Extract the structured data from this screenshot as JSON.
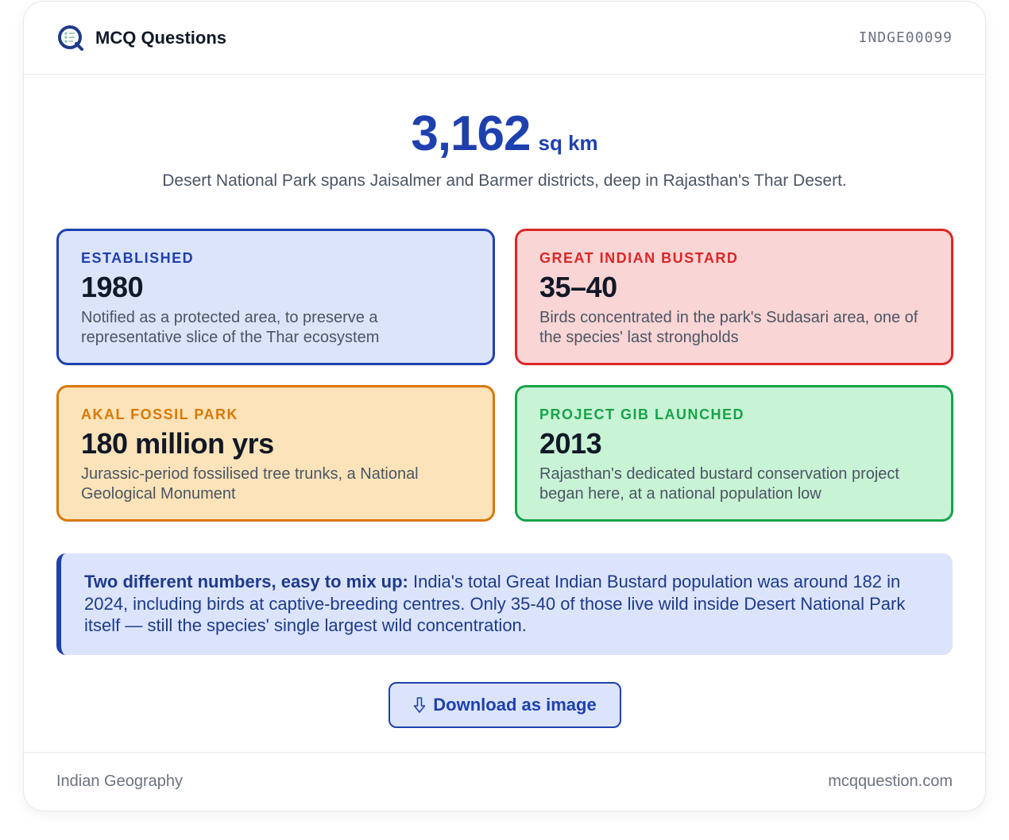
{
  "header": {
    "brand": "MCQ Questions",
    "code": "INDGE00099"
  },
  "hero": {
    "number": "3,162",
    "unit": "sq km",
    "subtitle": "Desert National Park spans Jaisalmer and Barmer districts, deep in Rajasthan's Thar Desert."
  },
  "stats": [
    {
      "label": "ESTABLISHED",
      "value": "1980",
      "desc": "Notified as a protected area, to preserve a representative slice of the Thar ecosystem",
      "accent": "#1e40af",
      "bg": "#dce4fa"
    },
    {
      "label": "GREAT INDIAN BUSTARD",
      "value": "35–40",
      "desc": "Birds concentrated in the park's Sudasari area, one of the species' last strongholds",
      "accent": "#dc2626",
      "bg": "#fad5d6"
    },
    {
      "label": "AKAL FOSSIL PARK",
      "value": "180 million yrs",
      "desc": "Jurassic-period fossilised tree trunks, a National Geological Monument",
      "accent": "#d97706",
      "bg": "#fce3b9"
    },
    {
      "label": "PROJECT GIB LAUNCHED",
      "value": "2013",
      "desc": "Rajasthan's dedicated bustard conservation project began here, at a national population low",
      "accent": "#16a34a",
      "bg": "#c8f3d5"
    }
  ],
  "note": {
    "lead": "Two different numbers, easy to mix up:",
    "text": " India's total Great Indian Bustard population was around 182 in 2024, including birds at captive-breeding centres. Only 35-40 of those live wild inside Desert National Park itself — still the species' single largest wild concentration."
  },
  "download": {
    "label": "Download as image",
    "icon": "download-arrow-icon"
  },
  "footer": {
    "category": "Indian Geography",
    "site": "mcqquestion.com"
  },
  "colors": {
    "primary": "#1e40af",
    "logo_accent": "#9dc8b5"
  }
}
